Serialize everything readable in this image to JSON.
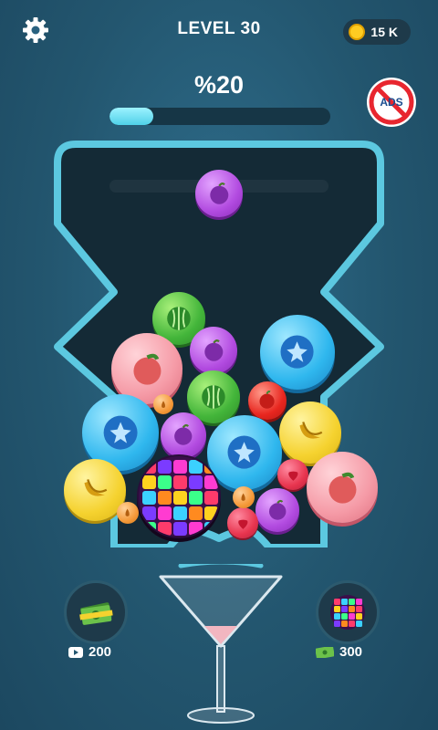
{
  "header": {
    "level_label": "LEVEL 30",
    "coins": "15 K",
    "settings_icon": "gear-icon",
    "coin_icon": "coin-icon"
  },
  "progress": {
    "percent_label": "%20",
    "fraction": 0.2
  },
  "no_ads": {
    "text": "ADS",
    "icon": "no-ads-icon"
  },
  "current_drop": {
    "fruit": "plum",
    "color": "#b24be0"
  },
  "board_pieces": [
    {
      "fruit": "watermelon"
    },
    {
      "fruit": "plum"
    },
    {
      "fruit": "blueberry"
    },
    {
      "fruit": "peach"
    },
    {
      "fruit": "watermelon"
    },
    {
      "fruit": "apple"
    },
    {
      "fruit": "blueberry"
    },
    {
      "fruit": "banana"
    },
    {
      "fruit": "plum"
    },
    {
      "fruit": "blueberry"
    },
    {
      "fruit": "strawberry"
    },
    {
      "fruit": "peach"
    },
    {
      "fruit": "banana"
    },
    {
      "fruit": "disco-ball"
    },
    {
      "fruit": "plum"
    },
    {
      "fruit": "strawberry"
    },
    {
      "fruit": "pear"
    },
    {
      "fruit": "pear"
    },
    {
      "fruit": "pear"
    }
  ],
  "boosters": {
    "money": {
      "price": "200",
      "icon": "video-play-icon"
    },
    "disco": {
      "price": "300",
      "icon": "cash-icon"
    }
  },
  "colors": {
    "accent": "#4fd1e8",
    "frame": "#5cc8e0",
    "board_bg": "#142a36"
  }
}
